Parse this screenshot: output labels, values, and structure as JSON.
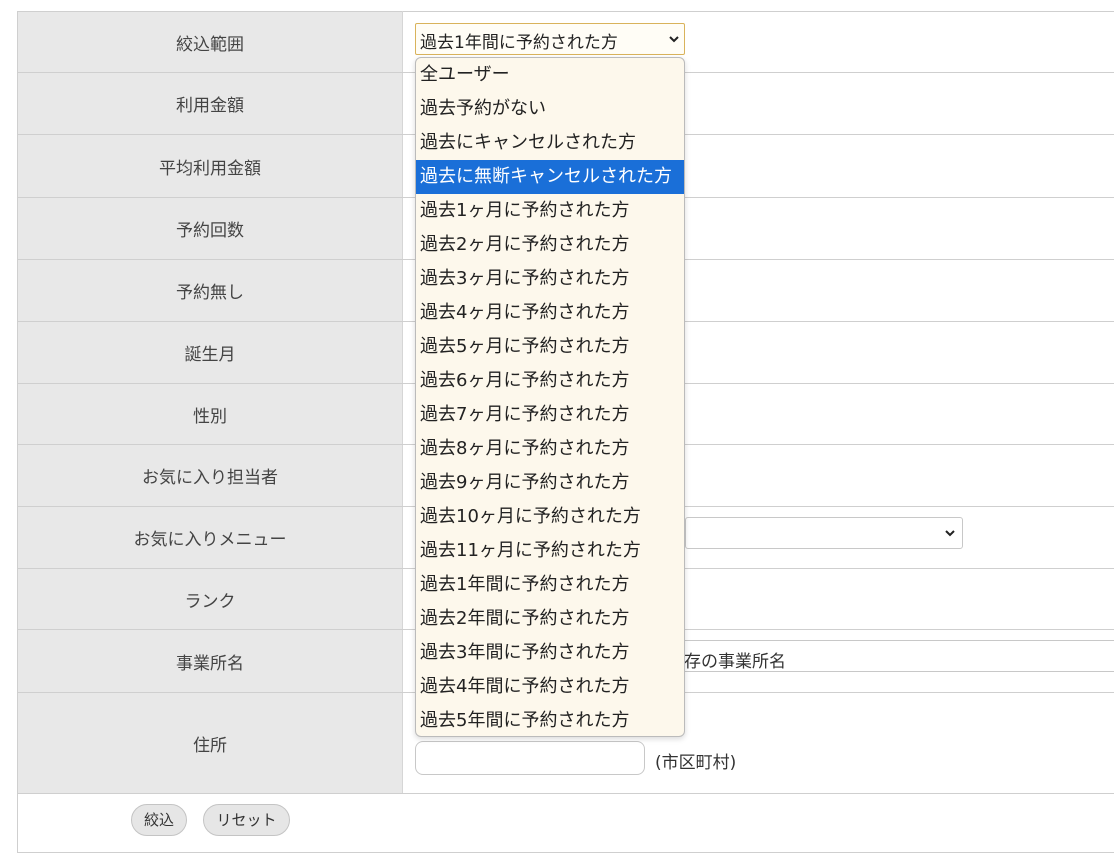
{
  "form": {
    "rows": [
      {
        "label": "絞込範囲"
      },
      {
        "label": "利用金額"
      },
      {
        "label": "平均利用金額"
      },
      {
        "label": "予約回数"
      },
      {
        "label": "予約無し"
      },
      {
        "label": "誕生月"
      },
      {
        "label": "性別"
      },
      {
        "label": "お気に入り担当者"
      },
      {
        "label": "お気に入りメニュー"
      },
      {
        "label": "ランク"
      },
      {
        "label": "事業所名"
      },
      {
        "label": "住所"
      }
    ],
    "filter_select_value": "過去1年間に予約された方",
    "office_hint_visible": "既存の事業所名",
    "city_label": "(市区町村)"
  },
  "buttons": {
    "filter": "絞込",
    "reset": "リセット"
  },
  "dropdown": {
    "options": [
      "全ユーザー",
      "過去予約がない",
      "過去にキャンセルされた方",
      "過去に無断キャンセルされた方",
      "過去1ヶ月に予約された方",
      "過去2ヶ月に予約された方",
      "過去3ヶ月に予約された方",
      "過去4ヶ月に予約された方",
      "過去5ヶ月に予約された方",
      "過去6ヶ月に予約された方",
      "過去7ヶ月に予約された方",
      "過去8ヶ月に予約された方",
      "過去9ヶ月に予約された方",
      "過去10ヶ月に予約された方",
      "過去11ヶ月に予約された方",
      "過去1年間に予約された方",
      "過去2年間に予約された方",
      "過去3年間に予約された方",
      "過去4年間に予約された方",
      "過去5年間に予約された方"
    ],
    "highlighted": "過去に無断キャンセルされた方"
  },
  "colors": {
    "highlight": "#1a6fd8",
    "dropdown_bg": "#fdf8ec",
    "label_bg": "#e8e8e8"
  },
  "icons": {
    "select_arrow": "chevron-down-icon"
  }
}
